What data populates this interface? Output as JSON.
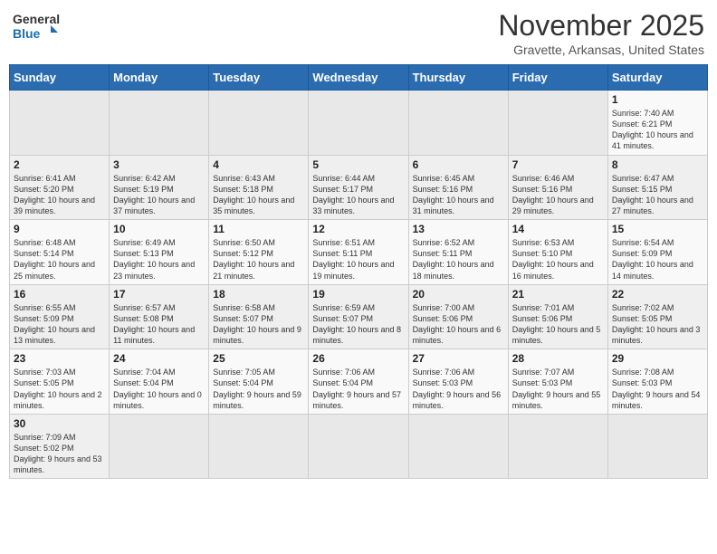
{
  "header": {
    "logo_general": "General",
    "logo_blue": "Blue",
    "month": "November 2025",
    "location": "Gravette, Arkansas, United States"
  },
  "weekdays": [
    "Sunday",
    "Monday",
    "Tuesday",
    "Wednesday",
    "Thursday",
    "Friday",
    "Saturday"
  ],
  "weeks": [
    [
      {
        "day": "",
        "info": ""
      },
      {
        "day": "",
        "info": ""
      },
      {
        "day": "",
        "info": ""
      },
      {
        "day": "",
        "info": ""
      },
      {
        "day": "",
        "info": ""
      },
      {
        "day": "",
        "info": ""
      },
      {
        "day": "1",
        "info": "Sunrise: 7:40 AM\nSunset: 6:21 PM\nDaylight: 10 hours and 41 minutes."
      }
    ],
    [
      {
        "day": "2",
        "info": "Sunrise: 6:41 AM\nSunset: 5:20 PM\nDaylight: 10 hours and 39 minutes."
      },
      {
        "day": "3",
        "info": "Sunrise: 6:42 AM\nSunset: 5:19 PM\nDaylight: 10 hours and 37 minutes."
      },
      {
        "day": "4",
        "info": "Sunrise: 6:43 AM\nSunset: 5:18 PM\nDaylight: 10 hours and 35 minutes."
      },
      {
        "day": "5",
        "info": "Sunrise: 6:44 AM\nSunset: 5:17 PM\nDaylight: 10 hours and 33 minutes."
      },
      {
        "day": "6",
        "info": "Sunrise: 6:45 AM\nSunset: 5:16 PM\nDaylight: 10 hours and 31 minutes."
      },
      {
        "day": "7",
        "info": "Sunrise: 6:46 AM\nSunset: 5:16 PM\nDaylight: 10 hours and 29 minutes."
      },
      {
        "day": "8",
        "info": "Sunrise: 6:47 AM\nSunset: 5:15 PM\nDaylight: 10 hours and 27 minutes."
      }
    ],
    [
      {
        "day": "9",
        "info": "Sunrise: 6:48 AM\nSunset: 5:14 PM\nDaylight: 10 hours and 25 minutes."
      },
      {
        "day": "10",
        "info": "Sunrise: 6:49 AM\nSunset: 5:13 PM\nDaylight: 10 hours and 23 minutes."
      },
      {
        "day": "11",
        "info": "Sunrise: 6:50 AM\nSunset: 5:12 PM\nDaylight: 10 hours and 21 minutes."
      },
      {
        "day": "12",
        "info": "Sunrise: 6:51 AM\nSunset: 5:11 PM\nDaylight: 10 hours and 19 minutes."
      },
      {
        "day": "13",
        "info": "Sunrise: 6:52 AM\nSunset: 5:11 PM\nDaylight: 10 hours and 18 minutes."
      },
      {
        "day": "14",
        "info": "Sunrise: 6:53 AM\nSunset: 5:10 PM\nDaylight: 10 hours and 16 minutes."
      },
      {
        "day": "15",
        "info": "Sunrise: 6:54 AM\nSunset: 5:09 PM\nDaylight: 10 hours and 14 minutes."
      }
    ],
    [
      {
        "day": "16",
        "info": "Sunrise: 6:55 AM\nSunset: 5:09 PM\nDaylight: 10 hours and 13 minutes."
      },
      {
        "day": "17",
        "info": "Sunrise: 6:57 AM\nSunset: 5:08 PM\nDaylight: 10 hours and 11 minutes."
      },
      {
        "day": "18",
        "info": "Sunrise: 6:58 AM\nSunset: 5:07 PM\nDaylight: 10 hours and 9 minutes."
      },
      {
        "day": "19",
        "info": "Sunrise: 6:59 AM\nSunset: 5:07 PM\nDaylight: 10 hours and 8 minutes."
      },
      {
        "day": "20",
        "info": "Sunrise: 7:00 AM\nSunset: 5:06 PM\nDaylight: 10 hours and 6 minutes."
      },
      {
        "day": "21",
        "info": "Sunrise: 7:01 AM\nSunset: 5:06 PM\nDaylight: 10 hours and 5 minutes."
      },
      {
        "day": "22",
        "info": "Sunrise: 7:02 AM\nSunset: 5:05 PM\nDaylight: 10 hours and 3 minutes."
      }
    ],
    [
      {
        "day": "23",
        "info": "Sunrise: 7:03 AM\nSunset: 5:05 PM\nDaylight: 10 hours and 2 minutes."
      },
      {
        "day": "24",
        "info": "Sunrise: 7:04 AM\nSunset: 5:04 PM\nDaylight: 10 hours and 0 minutes."
      },
      {
        "day": "25",
        "info": "Sunrise: 7:05 AM\nSunset: 5:04 PM\nDaylight: 9 hours and 59 minutes."
      },
      {
        "day": "26",
        "info": "Sunrise: 7:06 AM\nSunset: 5:04 PM\nDaylight: 9 hours and 57 minutes."
      },
      {
        "day": "27",
        "info": "Sunrise: 7:06 AM\nSunset: 5:03 PM\nDaylight: 9 hours and 56 minutes."
      },
      {
        "day": "28",
        "info": "Sunrise: 7:07 AM\nSunset: 5:03 PM\nDaylight: 9 hours and 55 minutes."
      },
      {
        "day": "29",
        "info": "Sunrise: 7:08 AM\nSunset: 5:03 PM\nDaylight: 9 hours and 54 minutes."
      }
    ],
    [
      {
        "day": "30",
        "info": "Sunrise: 7:09 AM\nSunset: 5:02 PM\nDaylight: 9 hours and 53 minutes."
      },
      {
        "day": "",
        "info": ""
      },
      {
        "day": "",
        "info": ""
      },
      {
        "day": "",
        "info": ""
      },
      {
        "day": "",
        "info": ""
      },
      {
        "day": "",
        "info": ""
      },
      {
        "day": "",
        "info": ""
      }
    ]
  ]
}
